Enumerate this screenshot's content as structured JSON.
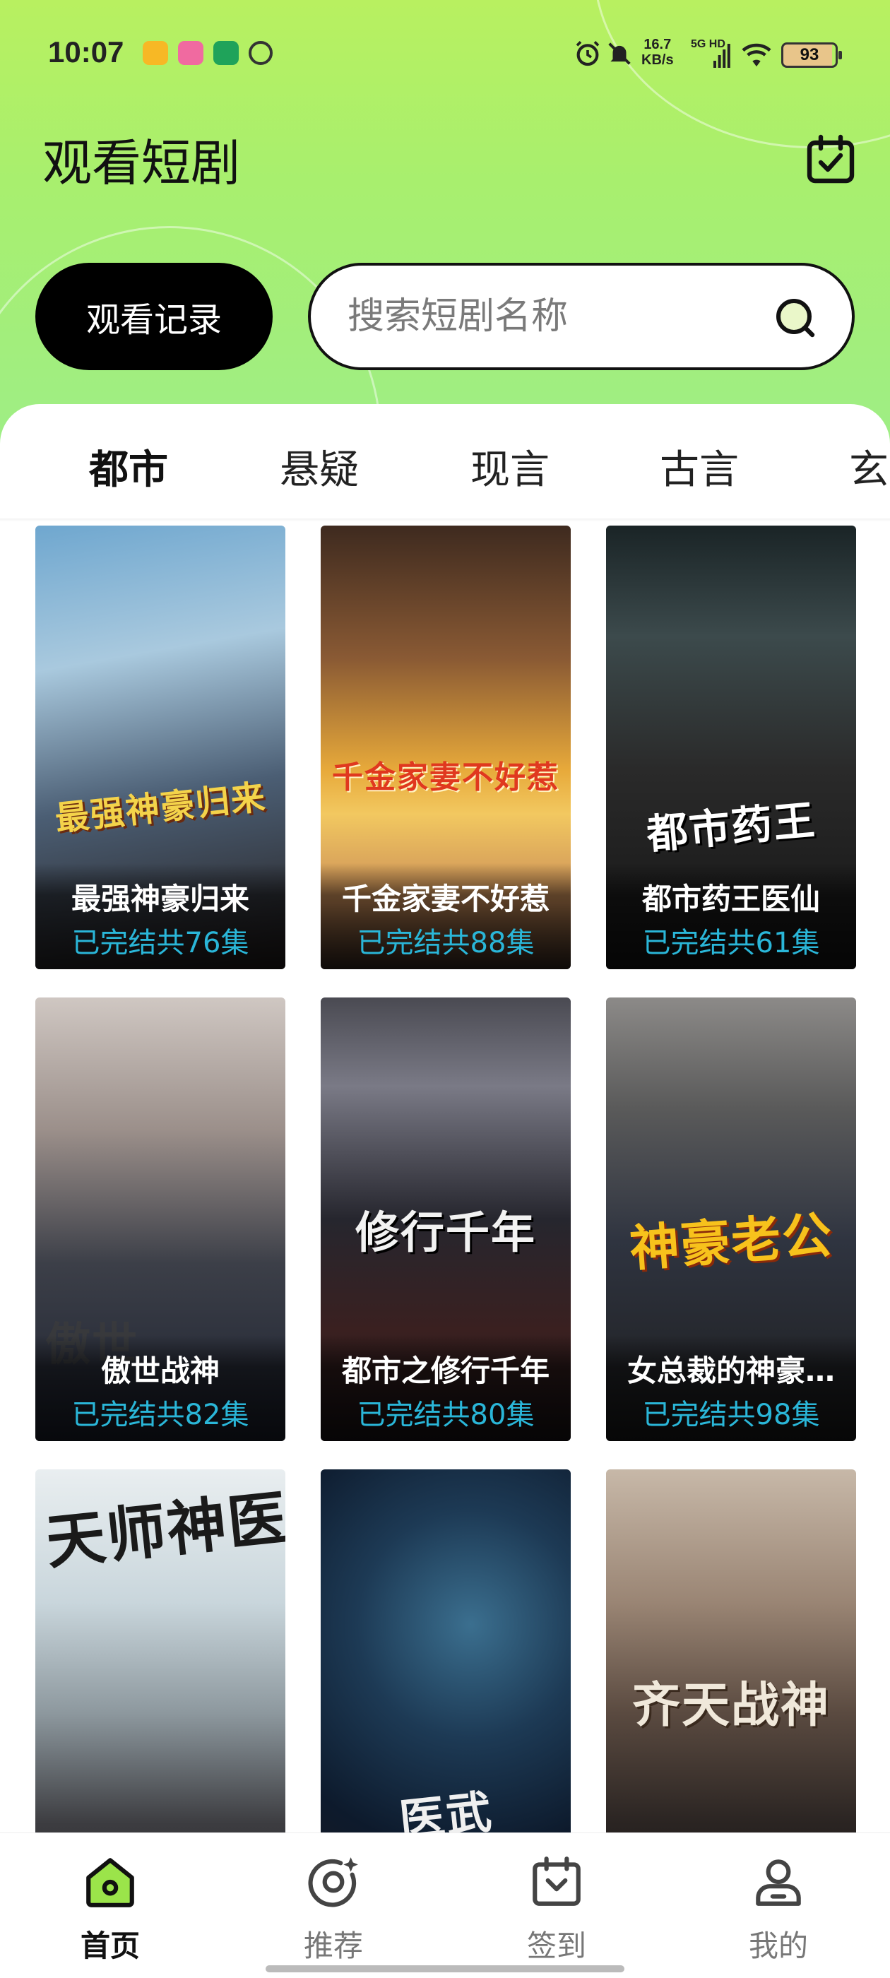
{
  "status_bar": {
    "time": "10:07",
    "net_speed_value": "16.7",
    "net_speed_unit": "KB/s",
    "net_type_top": "5G HD",
    "battery": "93"
  },
  "header": {
    "title": "观看短剧",
    "history_button": "观看记录",
    "search_placeholder": "搜索短剧名称"
  },
  "tabs": [
    {
      "label": "都市",
      "active": true
    },
    {
      "label": "悬疑"
    },
    {
      "label": "现言"
    },
    {
      "label": "古言"
    },
    {
      "label": "玄"
    }
  ],
  "dramas": [
    {
      "title": "最强神豪归来",
      "episodes": "已完结共76集",
      "poster_text": "最强神豪归来"
    },
    {
      "title": "千金家妻不好惹",
      "episodes": "已完结共88集",
      "poster_text": "千金家妻不好惹"
    },
    {
      "title": "都市药王医仙",
      "episodes": "已完结共61集",
      "poster_text": "都市药王"
    },
    {
      "title": "傲世战神",
      "episodes": "已完结共82集",
      "poster_text": "傲世"
    },
    {
      "title": "都市之修行千年",
      "episodes": "已完结共80集",
      "poster_text": "修行千年"
    },
    {
      "title": "女总裁的神豪…",
      "episodes": "已完结共98集",
      "poster_text": "神豪老公"
    },
    {
      "title": "",
      "episodes": "",
      "poster_text": "天师神医"
    },
    {
      "title": "",
      "episodes": "",
      "poster_text": "医武"
    },
    {
      "title": "",
      "episodes": "",
      "poster_text": "齐天战神"
    }
  ],
  "bottom_nav": [
    {
      "label": "首页",
      "icon": "home-icon",
      "active": true
    },
    {
      "label": "推荐",
      "icon": "discover-icon"
    },
    {
      "label": "签到",
      "icon": "checkin-icon"
    },
    {
      "label": "我的",
      "icon": "profile-icon"
    }
  ],
  "colors": {
    "accent_green": "#9be44a",
    "episode_text": "#2ab6d8",
    "header_gradient_top": "#b8f060"
  }
}
